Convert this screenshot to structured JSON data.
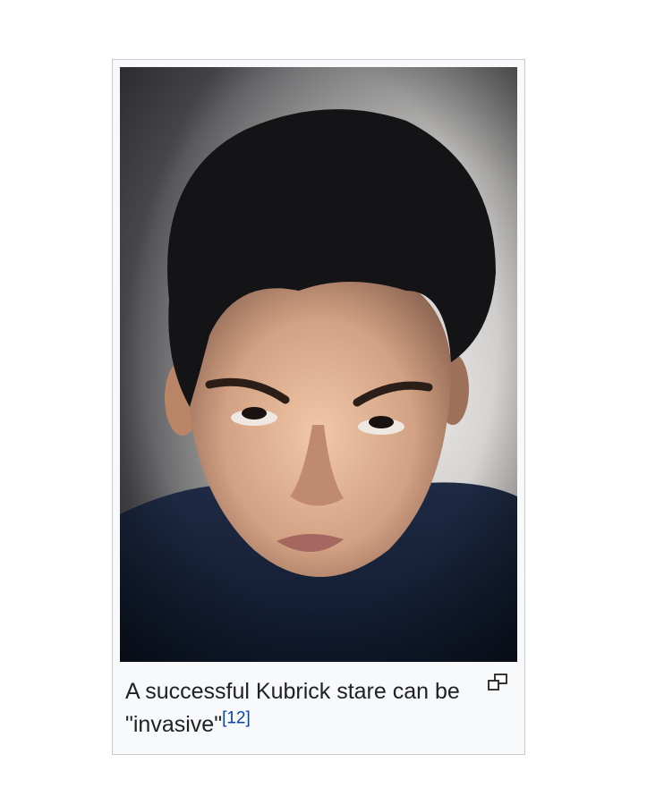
{
  "figure": {
    "image_subject": "photo-portrait",
    "caption_text": "A successful Kubrick stare can be \"invasive\"",
    "citation": "[12]",
    "enlarge_icon": "magnify-clip-icon"
  },
  "colors": {
    "border": "#c8ccd1",
    "frame_background": "#f8f9fa",
    "caption_text": "#202122",
    "link": "#0645ad"
  }
}
